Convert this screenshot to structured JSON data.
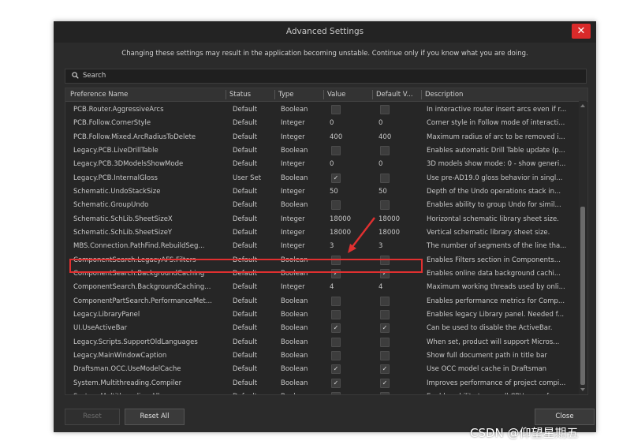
{
  "window": {
    "title": "Advanced Settings",
    "close_symbol": "✕",
    "warning": "Changing these settings may result in the application becoming unstable. Continue only if you know what you are doing."
  },
  "search": {
    "label": "Search"
  },
  "columns": {
    "name": "Preference Name",
    "status": "Status",
    "type": "Type",
    "value": "Value",
    "default": "Default V...",
    "description": "Description"
  },
  "rows": [
    {
      "name": "PCB.Router.AggressiveArcs",
      "status": "Default",
      "type": "Boolean",
      "value": "unchecked",
      "default": "unchecked",
      "description": "In interactive router insert arcs even if r..."
    },
    {
      "name": "PCB.Follow.CornerStyle",
      "status": "Default",
      "type": "Integer",
      "value": "0",
      "default": "0",
      "description": "Corner style in Follow mode of interacti..."
    },
    {
      "name": "PCB.Follow.Mixed.ArcRadiusToDelete",
      "status": "Default",
      "type": "Integer",
      "value": "400",
      "default": "400",
      "description": "Maximum radius of arc to be removed i..."
    },
    {
      "name": "Legacy.PCB.LiveDrillTable",
      "status": "Default",
      "type": "Boolean",
      "value": "unchecked",
      "default": "unchecked",
      "description": "Enables automatic Drill Table update (p..."
    },
    {
      "name": "Legacy.PCB.3DModelsShowMode",
      "status": "Default",
      "type": "Integer",
      "value": "0",
      "default": "0",
      "description": "3D models show mode: 0 - show generi..."
    },
    {
      "name": "Legacy.PCB.InternalGloss",
      "status": "User Set",
      "type": "Boolean",
      "value": "checked",
      "default": "unchecked",
      "description": "Use pre-AD19.0 gloss behavior in singl..."
    },
    {
      "name": "Schematic.UndoStackSize",
      "status": "Default",
      "type": "Integer",
      "value": "50",
      "default": "50",
      "description": "Depth of the Undo operations stack in..."
    },
    {
      "name": "Schematic.GroupUndo",
      "status": "Default",
      "type": "Boolean",
      "value": "unchecked",
      "default": "unchecked",
      "description": "Enables ability to group Undo for simil..."
    },
    {
      "name": "Schematic.SchLib.SheetSizeX",
      "status": "Default",
      "type": "Integer",
      "value": "18000",
      "default": "18000",
      "description": "Horizontal schematic library sheet size."
    },
    {
      "name": "Schematic.SchLib.SheetSizeY",
      "status": "Default",
      "type": "Integer",
      "value": "18000",
      "default": "18000",
      "description": "Vertical schematic library sheet size."
    },
    {
      "name": "MBS.Connection.PathFind.RebuildSeg...",
      "status": "Default",
      "type": "Integer",
      "value": "3",
      "default": "3",
      "description": "The number of segments of the line tha..."
    },
    {
      "name": "ComponentSearch.LegacyAFS.Filters",
      "status": "Default",
      "type": "Boolean",
      "value": "unchecked",
      "default": "unchecked",
      "description": "Enables Filters section in Components..."
    },
    {
      "name": "ComponentSearch.BackgroundCaching",
      "status": "Default",
      "type": "Boolean",
      "value": "checked",
      "default": "checked",
      "description": "Enables online data background cachi..."
    },
    {
      "name": "ComponentSearch.BackgroundCaching...",
      "status": "Default",
      "type": "Integer",
      "value": "4",
      "default": "4",
      "description": "Maximum working threads used by onli..."
    },
    {
      "name": "ComponentPartSearch.PerformanceMet...",
      "status": "Default",
      "type": "Boolean",
      "value": "unchecked",
      "default": "unchecked",
      "description": "Enables performance metrics for Comp..."
    },
    {
      "name": "Legacy.LibraryPanel",
      "status": "Default",
      "type": "Boolean",
      "value": "unchecked",
      "default": "unchecked",
      "description": "Enables legacy Library panel. Needed f..."
    },
    {
      "name": "UI.UseActiveBar",
      "status": "Default",
      "type": "Boolean",
      "value": "checked",
      "default": "checked",
      "description": "Can be used to disable the ActiveBar."
    },
    {
      "name": "Legacy.Scripts.SupportOldLanguages",
      "status": "Default",
      "type": "Boolean",
      "value": "unchecked",
      "default": "unchecked",
      "description": "When set, product will support Micros..."
    },
    {
      "name": "Legacy.MainWindowCaption",
      "status": "Default",
      "type": "Boolean",
      "value": "unchecked",
      "default": "unchecked",
      "description": "Show full document path in title bar"
    },
    {
      "name": "Draftsman.OCC.UseModelCache",
      "status": "Default",
      "type": "Boolean",
      "value": "checked",
      "default": "checked",
      "description": "Use OCC model cache in Draftsman"
    },
    {
      "name": "System.Multithreading.Compiler",
      "status": "Default",
      "type": "Boolean",
      "value": "checked",
      "default": "checked",
      "description": "Improves performance of project compi..."
    },
    {
      "name": "System.Multithreading.All",
      "status": "Default",
      "type": "Boolean",
      "value": "unchecked",
      "default": "unchecked",
      "description": "Enables ability to use all CPU cores fo..."
    }
  ],
  "buttons": {
    "reset": "Reset",
    "reset_all": "Reset All",
    "close": "Close"
  },
  "watermark": "CSDN @仰望星期五",
  "colors": {
    "highlight": "#e03030",
    "close": "#d92a2a"
  }
}
